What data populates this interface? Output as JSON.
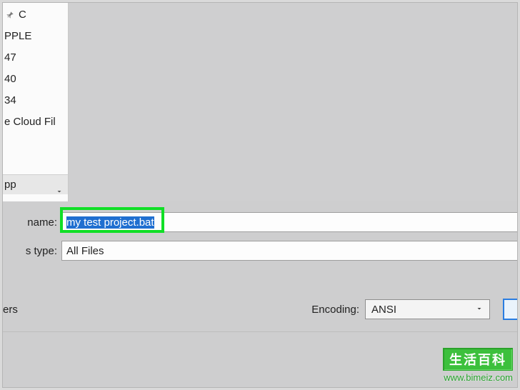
{
  "nav": {
    "items": [
      {
        "label": "C"
      },
      {
        "label": "PPLE"
      },
      {
        "label": "47"
      },
      {
        "label": "40"
      },
      {
        "label": "34"
      },
      {
        "label": "e Cloud Fil"
      }
    ],
    "lastItem": "pp"
  },
  "form": {
    "fileNameLabel": " name:",
    "fileNameValue": "my test project.bat",
    "saveTypeLabel": "s type:",
    "saveTypeValue": "All Files",
    "hideFoldersLabel": "ers",
    "encodingLabel": "Encoding:",
    "encodingValue": "ANSI"
  },
  "watermark": {
    "title": "生活百科",
    "url": "www.bimeiz.com"
  }
}
